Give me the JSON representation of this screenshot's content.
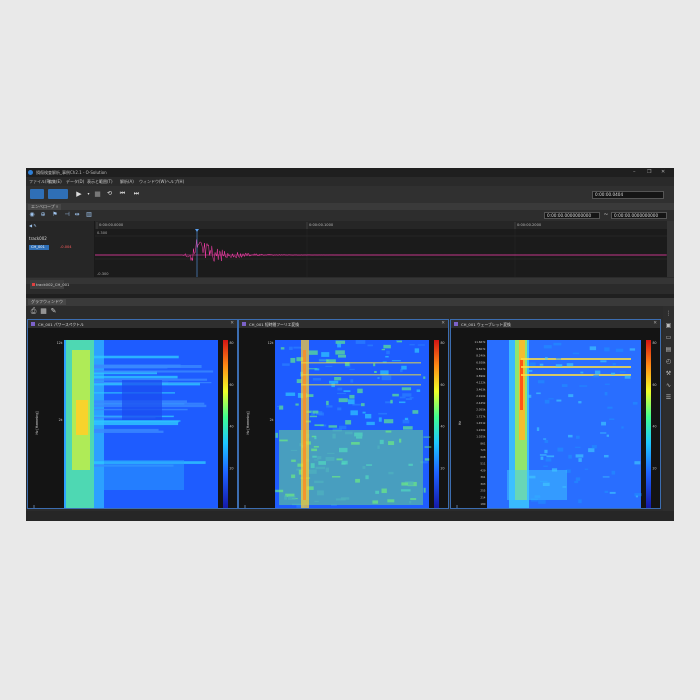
{
  "window": {
    "title": "損傷検査解析_事例Ch2.1 - O-Solution",
    "controls": [
      "–",
      "❐",
      "✕"
    ]
  },
  "menu": [
    "ファイル(F)",
    "編集(E)",
    "データ(D)",
    "表示と範囲(T)",
    "解析(A)",
    "ウィンドウ(W)",
    "ヘルプ(H)"
  ],
  "toolbar": {
    "time_display": "0:00:00.0404",
    "position_display_a": "0:00:00.0000000000",
    "position_display_b": "0:00:00.0000000000"
  },
  "waveform_panel": {
    "tab_label": "エンベロープ ☓",
    "track_name": "track002",
    "channel_label": "CH_001",
    "channel_value": "-0.004",
    "ruler_ticks": [
      "0:00:00.0000",
      "0:00:00.1000",
      "0:00:00.2000"
    ],
    "amp_top": "0.300",
    "amp_bottom": "-0.300",
    "track_tab_label": "track002_CH_001"
  },
  "spectrogram_area": {
    "tab_label": "グラフウィンドウ"
  },
  "spectrograms": [
    {
      "title": "CH_001 パワースペクトル",
      "y_axis_label": "Hz [Hamming]",
      "y_ticks": [
        "12k",
        "2k",
        "100"
      ],
      "x_ticks": [
        "0",
        "s"
      ],
      "cb_ticks": [
        "80",
        "60",
        "40",
        "20",
        "0"
      ],
      "style": "stft"
    },
    {
      "title": "CH_001 短時間フーリエ変換",
      "y_axis_label": "Hz [Hamming]",
      "y_ticks": [
        "12k",
        "2k",
        "100"
      ],
      "x_ticks": [
        "0",
        "s"
      ],
      "cb_ticks": [
        "80",
        "60",
        "40",
        "20",
        "0"
      ],
      "style": "fft"
    },
    {
      "title": "CH_001 ウェーブレット変換",
      "y_axis_label": "Hz",
      "y_ticks": [
        "11.667k",
        "9.807k",
        "8.240k",
        "6.928k",
        "5.827k",
        "4.896k",
        "4.122k",
        "3.463k",
        "2.910k",
        "2.445k",
        "2.055k",
        "1.727k",
        "1.451k",
        "1.220k",
        "1.025k",
        "861",
        "723",
        "608",
        "511",
        "429",
        "361",
        "303",
        "255",
        "214",
        "180",
        "151"
      ],
      "x_ticks": [
        "0",
        "s"
      ],
      "cb_ticks": [
        "80",
        "60",
        "40",
        "20",
        "0"
      ],
      "style": "wavelet"
    }
  ],
  "icons": {
    "app": "app-logo-icon",
    "play": "play-icon",
    "stop": "stop-icon",
    "loop": "loop-icon",
    "skip_back": "skip-back-icon",
    "skip_forward": "skip-forward-icon"
  },
  "colors": {
    "accent": "#2f6fb6",
    "waveform": "#ff3fb0",
    "panel_border": "#3c6db0"
  }
}
